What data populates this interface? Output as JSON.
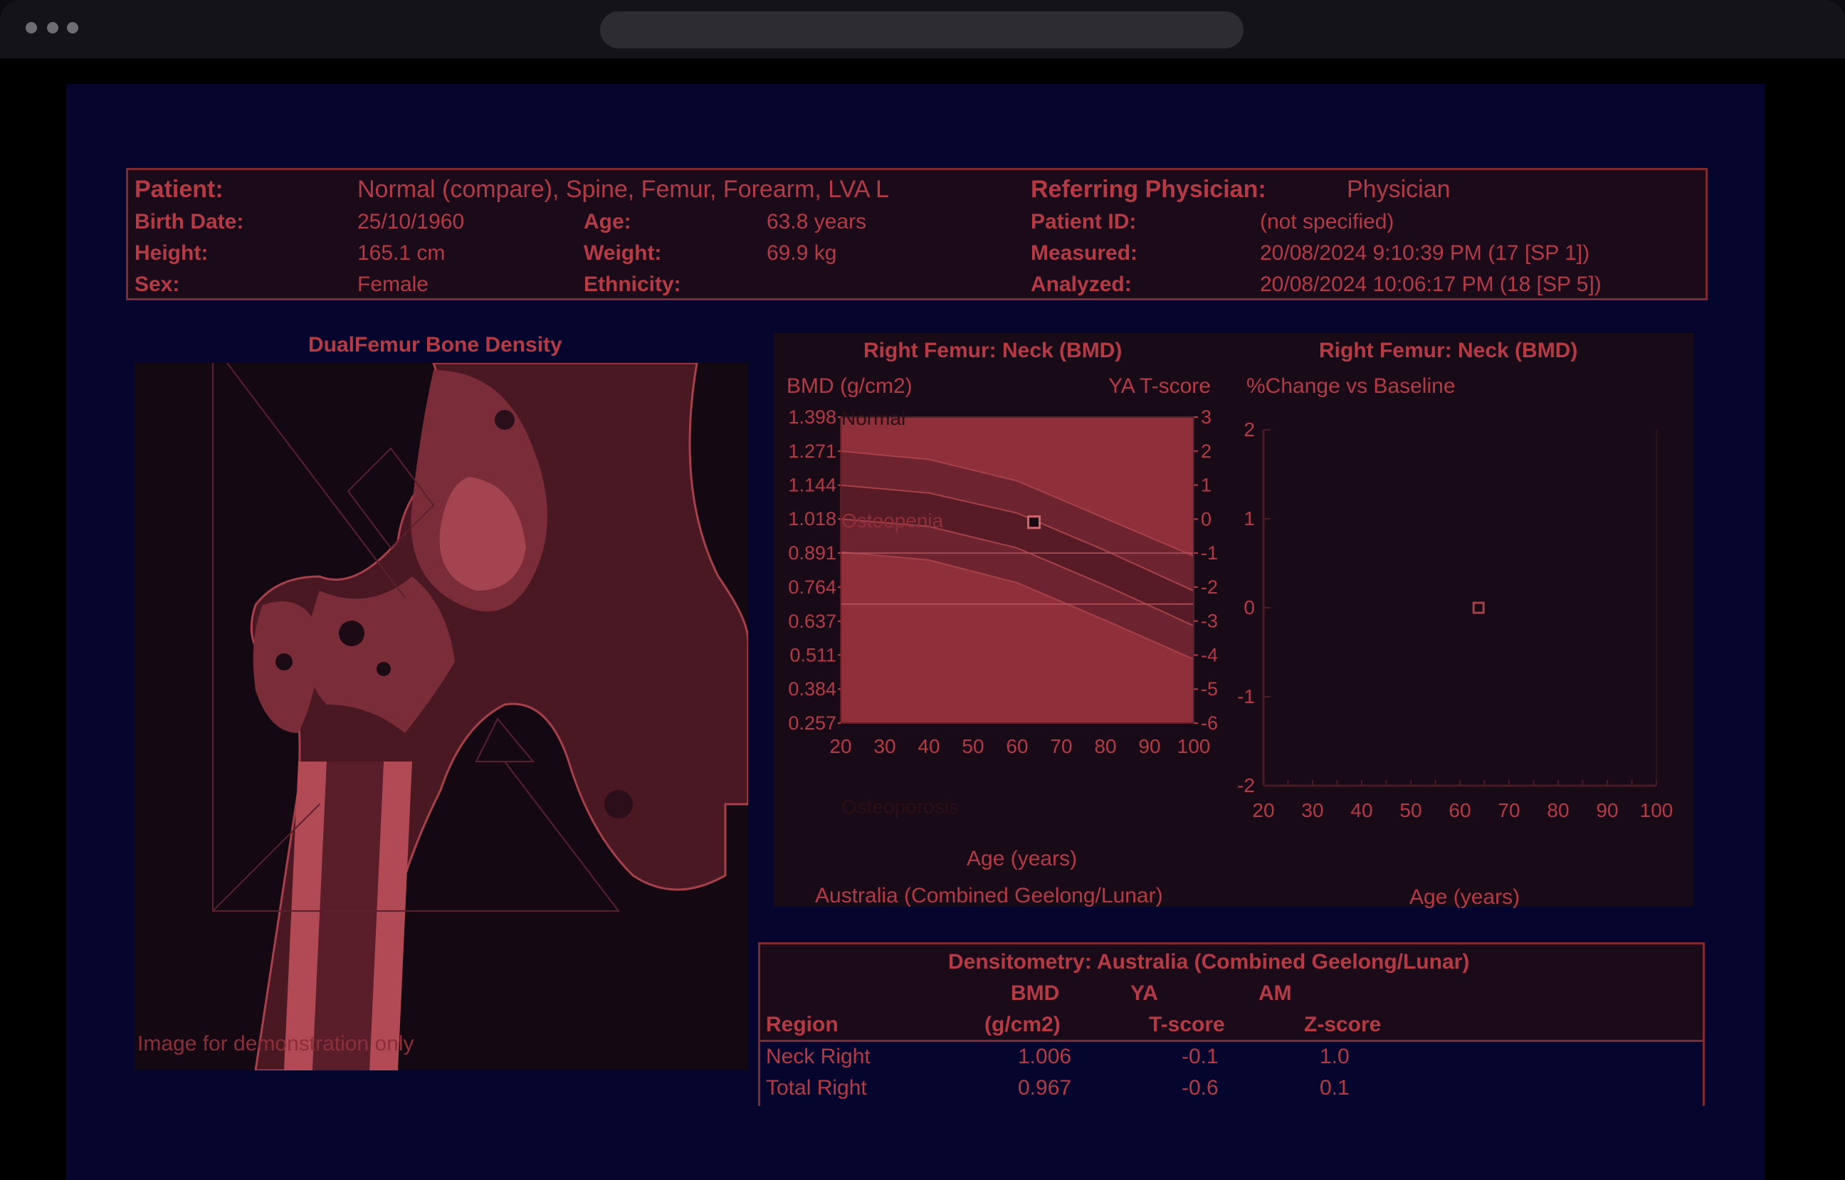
{
  "header": {
    "patient_label": "Patient:",
    "patient_value": "Normal (compare), Spine, Femur, Forearm, LVA L",
    "physician_label": "Referring Physician:",
    "physician_value": "Physician",
    "birth_label": "Birth Date:",
    "birth_value": "25/10/1960",
    "age_label": "Age:",
    "age_value": "63.8 years",
    "pid_label": "Patient ID:",
    "pid_value": "(not specified)",
    "height_label": "Height:",
    "height_value": "165.1 cm",
    "weight_label": "Weight:",
    "weight_value": "69.9 kg",
    "measured_label": "Measured:",
    "measured_value": "20/08/2024 9:10:39 PM (17 [SP 1])",
    "sex_label": "Sex:",
    "sex_value": "Female",
    "ethnicity_label": "Ethnicity:",
    "analyzed_label": "Analyzed:",
    "analyzed_value": "20/08/2024 10:06:17 PM (18 [SP 5])"
  },
  "image_panel": {
    "title": "DualFemur Bone Density",
    "watermark": "Image for demonstration only"
  },
  "charts_panel": {
    "left_title": "Right Femur: Neck (BMD)",
    "right_title": "Right Femur: Neck  (BMD)",
    "bmd_axis_label": "BMD (g/cm2)",
    "tscore_axis_label": "YA T-score",
    "change_axis_label": "%Change vs Baseline",
    "zone_normal": "Normal",
    "zone_osteopenia": "Osteopenia",
    "zone_osteoporosis": "Osteoporosis",
    "left_xlabel": "Age (years)",
    "right_xlabel": "Age (years)",
    "reference": "Australia (Combined Geelong/Lunar)"
  },
  "chart_data": [
    {
      "type": "line",
      "title": "Right Femur: Neck (BMD)",
      "ylabel": "BMD (g/cm2)",
      "y2label": "YA T-score",
      "xlabel": "Age (years)",
      "x_ticks": [
        "20",
        "30",
        "40",
        "50",
        "60",
        "70",
        "80",
        "90",
        "100"
      ],
      "y_ticks": [
        "1.398",
        "1.271",
        "1.144",
        "1.018",
        "0.891",
        "0.764",
        "0.637",
        "0.511",
        "0.384",
        "0.257"
      ],
      "y2_ticks": [
        "3",
        "2",
        "1",
        "0",
        "-1",
        "-2",
        "-3",
        "-4",
        "-5",
        "-6"
      ],
      "xlim": [
        20,
        100
      ],
      "ylim": [
        0.257,
        1.398
      ],
      "y2lim": [
        -6,
        3
      ],
      "zones": [
        {
          "name": "Normal",
          "tscore_from": -1,
          "tscore_to": 3
        },
        {
          "name": "Osteopenia",
          "tscore_from": -2.5,
          "tscore_to": -1
        },
        {
          "name": "Osteoporosis",
          "tscore_from": -6,
          "tscore_to": -2.5
        }
      ],
      "reference_curves": [
        {
          "age": [
            20,
            40,
            60,
            80,
            100
          ],
          "bmd": [
            1.271,
            1.24,
            1.16,
            1.02,
            0.88
          ]
        },
        {
          "age": [
            20,
            40,
            60,
            80,
            100
          ],
          "bmd": [
            1.144,
            1.115,
            1.04,
            0.9,
            0.75
          ]
        },
        {
          "age": [
            20,
            40,
            60,
            80,
            100
          ],
          "bmd": [
            1.018,
            0.99,
            0.91,
            0.77,
            0.62
          ]
        },
        {
          "age": [
            20,
            40,
            60,
            80,
            100
          ],
          "bmd": [
            0.895,
            0.865,
            0.78,
            0.64,
            0.495
          ]
        }
      ],
      "points": [
        {
          "x": 63.8,
          "y": 1.006
        }
      ],
      "note": "Australia (Combined Geelong/Lunar)"
    },
    {
      "type": "scatter",
      "title": "Right Femur: Neck  (BMD)",
      "ylabel": "%Change vs Baseline",
      "xlabel": "Age (years)",
      "x_ticks": [
        "20",
        "30",
        "40",
        "50",
        "60",
        "70",
        "80",
        "90",
        "100"
      ],
      "y_ticks": [
        "2",
        "1",
        "0",
        "-1",
        "-2"
      ],
      "xlim": [
        20,
        100
      ],
      "ylim": [
        -2,
        2
      ],
      "points": [
        {
          "x": 63.8,
          "y": 0
        }
      ]
    }
  ],
  "densitometry": {
    "title": "Densitometry: Australia (Combined Geelong/Lunar)",
    "col_region": "Region",
    "col_bmd_top": "BMD",
    "col_bmd_bottom": "(g/cm2)",
    "col_ya_top": "YA",
    "col_ya_bottom": "T-score",
    "col_am_top": "AM",
    "col_am_bottom": "Z-score",
    "rows": [
      {
        "region": "Neck Right",
        "bmd": "1.006",
        "t": "-0.1",
        "z": "1.0"
      },
      {
        "region": "Total Right",
        "bmd": "0.967",
        "t": "-0.6",
        "z": "0.1"
      }
    ]
  },
  "colors": {
    "accent": "#b53a44",
    "background": "#05052d",
    "panel": "#190a18",
    "zone_fill": "#8f2f3a"
  }
}
